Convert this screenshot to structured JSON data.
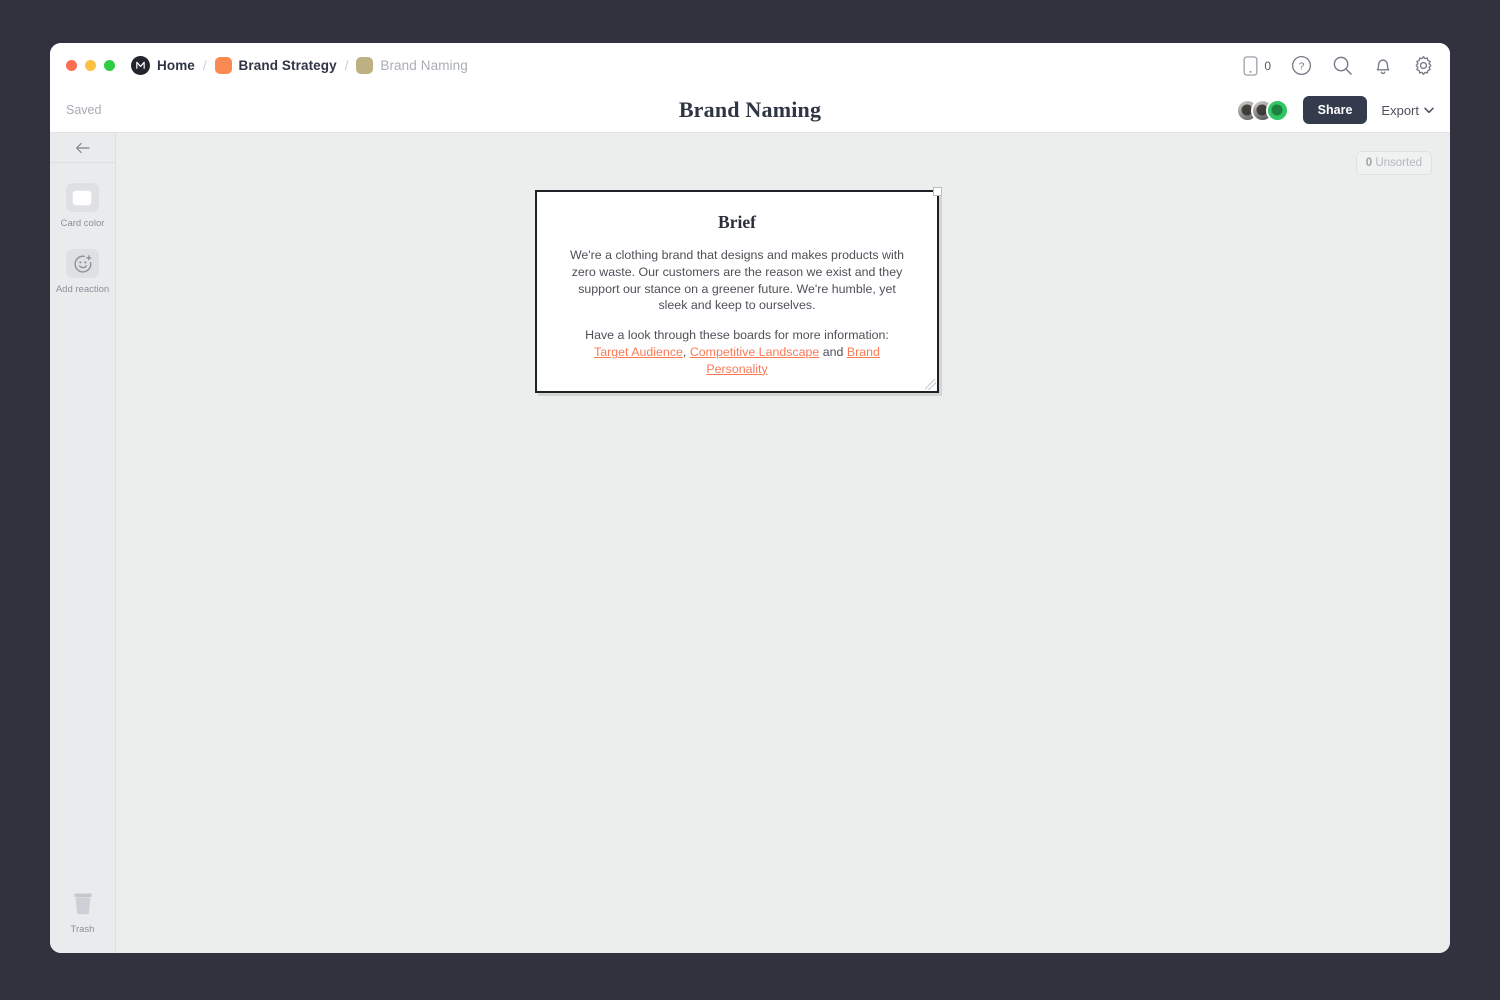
{
  "titlebar": {
    "traffic_lights": [
      "close",
      "minimize",
      "maximize"
    ],
    "breadcrumbs": [
      {
        "label": "Home",
        "icon": "milanote-logo-icon",
        "muted": false
      },
      {
        "label": "Brand Strategy",
        "icon": "orange-board-icon",
        "muted": false
      },
      {
        "label": "Brand Naming",
        "icon": "olive-board-icon",
        "muted": true
      }
    ],
    "separator": "/",
    "right_icons": [
      {
        "name": "mobile-device-icon",
        "badge": "0"
      },
      {
        "name": "help-icon"
      },
      {
        "name": "search-icon"
      },
      {
        "name": "notifications-bell-icon"
      },
      {
        "name": "settings-gear-icon"
      }
    ]
  },
  "header": {
    "save_status": "Saved",
    "title": "Brand Naming",
    "share_label": "Share",
    "export_label": "Export",
    "collaborators": [
      "avatar-1",
      "avatar-2",
      "avatar-3"
    ]
  },
  "sidebar": {
    "collapse_icon": "arrow-left-icon",
    "tools": [
      {
        "label": "Card color",
        "icon": "color-swatch-icon"
      },
      {
        "label": "Add reaction",
        "icon": "add-reaction-icon"
      }
    ],
    "trash_label": "Trash"
  },
  "canvas": {
    "unsorted_count": "0",
    "unsorted_label": "Unsorted",
    "card": {
      "title": "Brief",
      "paragraph1": "We're a clothing brand that designs and makes products with zero waste. Our customers are the reason we exist and they support our stance on a greener future. We're humble, yet sleek and keep to ourselves.",
      "paragraph2_prefix": "Have a look through these boards for more information: ",
      "link1": "Target Audience",
      "sep1": ", ",
      "link2": "Competitive Landscape",
      "sep2": " and ",
      "link3": "Brand Personality"
    }
  },
  "colors": {
    "app_background": "#32323e",
    "canvas": "#eceded",
    "sidebar": "#eaebed",
    "share_button": "#343b4d",
    "link": "#fa7a56",
    "board_orange": "#fb8a52",
    "board_olive": "#bdb184",
    "presence_green": "#2ec763"
  }
}
